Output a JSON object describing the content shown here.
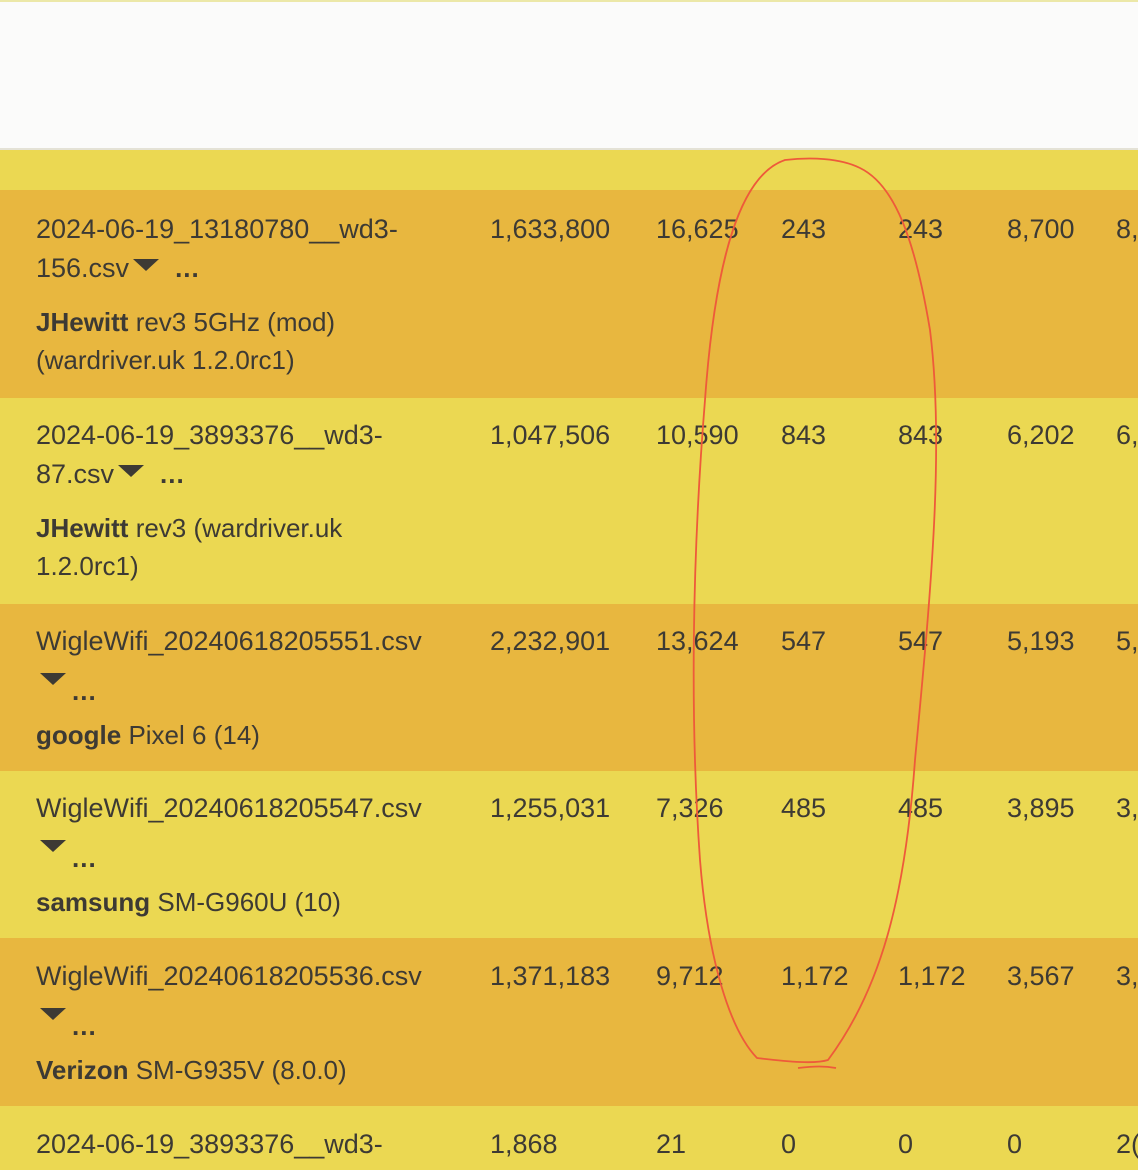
{
  "rows": [
    {
      "file_line1": "2024-06-19_13180780__wd3-",
      "file_line2": "156.csv",
      "more": "...",
      "device_brand": "JHewitt",
      "device_model": " rev3 5GHz (mod)",
      "device_line2": "(wardriver.uk 1.2.0rc1)",
      "cols": [
        "1,633,800",
        "16,625",
        "243",
        "243",
        "8,700",
        "8,"
      ]
    },
    {
      "file_line1": "2024-06-19_3893376__wd3-",
      "file_line2": "87.csv",
      "more": "...",
      "device_brand": "JHewitt",
      "device_model": " rev3 (wardriver.uk",
      "device_line2": "1.2.0rc1)",
      "cols": [
        "1,047,506",
        "10,590",
        "843",
        "843",
        "6,202",
        "6,"
      ]
    },
    {
      "file_line1": "WigleWifi_20240618205551.csv",
      "more": "...",
      "device_brand": "google",
      "device_model": " Pixel 6 (14)",
      "cols": [
        "2,232,901",
        "13,624",
        "547",
        "547",
        "5,193",
        "5,"
      ]
    },
    {
      "file_line1": "WigleWifi_20240618205547.csv",
      "more": "...",
      "device_brand": "samsung",
      "device_model": " SM-G960U (10)",
      "cols": [
        "1,255,031",
        "7,326",
        "485",
        "485",
        "3,895",
        "3,"
      ]
    },
    {
      "file_line1": "WigleWifi_20240618205536.csv",
      "more": "...",
      "device_brand": "Verizon",
      "device_model": " SM-G935V (8.0.0)",
      "cols": [
        "1,371,183",
        "9,712",
        "1,172",
        "1,172",
        "3,567",
        "3,"
      ]
    },
    {
      "file_line1": "2024-06-19_3893376__wd3-",
      "cols": [
        "1,868",
        "21",
        "0",
        "0",
        "0",
        "2("
      ]
    }
  ],
  "colors": {
    "row_dark": "#e8b73f",
    "row_light": "#ebd852",
    "annotation": "#ee5a3a"
  }
}
